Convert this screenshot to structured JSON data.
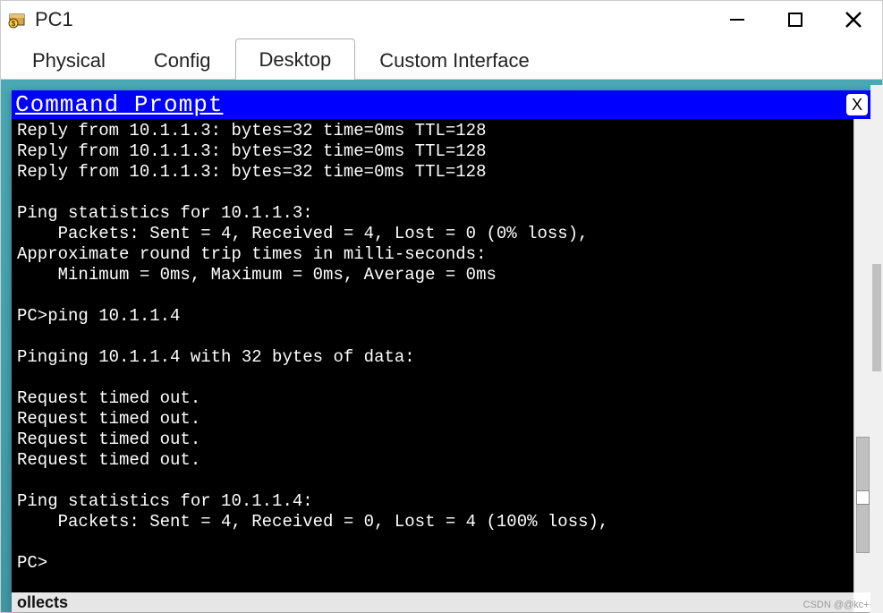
{
  "window": {
    "title": "PC1"
  },
  "tabs": [
    {
      "label": "Physical"
    },
    {
      "label": "Config"
    },
    {
      "label": "Desktop"
    },
    {
      "label": "Custom Interface"
    }
  ],
  "cmd": {
    "title": "Command Prompt",
    "close": "X"
  },
  "terminal_lines": [
    "Reply from 10.1.1.3: bytes=32 time=0ms TTL=128",
    "Reply from 10.1.1.3: bytes=32 time=0ms TTL=128",
    "Reply from 10.1.1.3: bytes=32 time=0ms TTL=128",
    "",
    "Ping statistics for 10.1.1.3:",
    "    Packets: Sent = 4, Received = 4, Lost = 0 (0% loss),",
    "Approximate round trip times in milli-seconds:",
    "    Minimum = 0ms, Maximum = 0ms, Average = 0ms",
    "",
    "PC>ping 10.1.1.4",
    "",
    "Pinging 10.1.1.4 with 32 bytes of data:",
    "",
    "Request timed out.",
    "Request timed out.",
    "Request timed out.",
    "Request timed out.",
    "",
    "Ping statistics for 10.1.1.4:",
    "    Packets: Sent = 4, Received = 0, Lost = 4 (100% loss),",
    "",
    "PC>"
  ],
  "bottom_text": "ollects",
  "watermark": "CSDN @@kc++"
}
